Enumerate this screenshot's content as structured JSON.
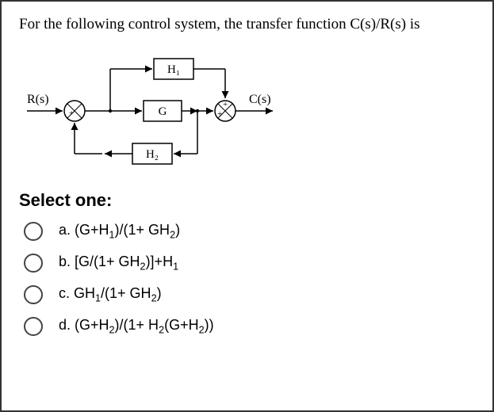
{
  "question": "For the following control system, the transfer function C(s)/R(s) is",
  "select_label": "Select one:",
  "diagram": {
    "input_label": "R(s)",
    "output_label": "C(s)",
    "block_top": "H1",
    "block_top_display": "H₁",
    "block_mid": "G",
    "block_bottom": "H2",
    "block_bottom_display": "H₂"
  },
  "options": [
    {
      "key": "a",
      "text_html": "a. (G+H<sub>1</sub>)/(1+ GH<sub>2</sub>)"
    },
    {
      "key": "b",
      "text_html": "b. [G/(1+ GH<sub>2</sub>)]+H<sub>1</sub>"
    },
    {
      "key": "c",
      "text_html": "c. GH<sub>1</sub>/(1+ GH<sub>2</sub>)"
    },
    {
      "key": "d",
      "text_html": "d. (G+H<sub>2</sub>)/(1+ H<sub>2</sub>(G+H<sub>2</sub>))"
    }
  ]
}
